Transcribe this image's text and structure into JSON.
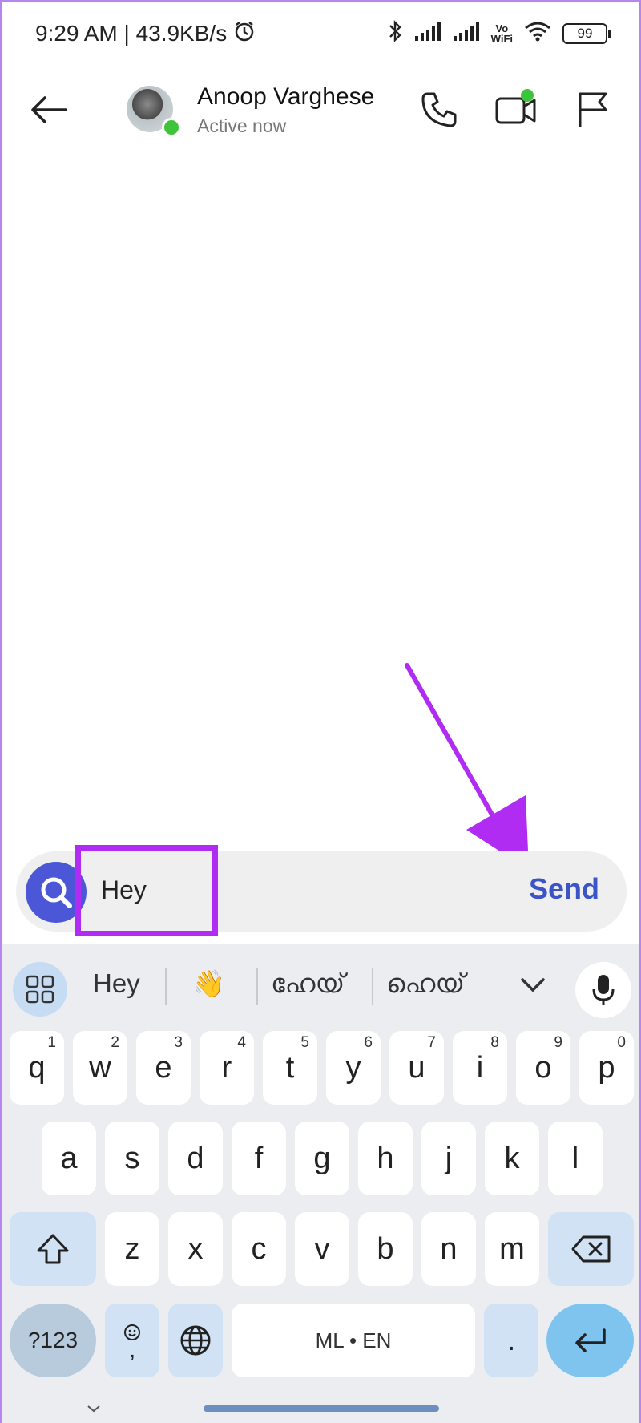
{
  "status_bar": {
    "time_speed": "9:29 AM | 43.9KB/s",
    "battery": "99",
    "vowifi_top": "Vo",
    "vowifi_bottom": "WiFi"
  },
  "header": {
    "contact_name": "Anoop Varghese",
    "contact_status": "Active now"
  },
  "composer": {
    "text": "Hey",
    "send_label": "Send"
  },
  "keyboard": {
    "suggestions": [
      "Hey",
      "👋",
      "ഹേയ്",
      "ഹെയ്"
    ],
    "row1": [
      {
        "k": "q",
        "n": "1"
      },
      {
        "k": "w",
        "n": "2"
      },
      {
        "k": "e",
        "n": "3"
      },
      {
        "k": "r",
        "n": "4"
      },
      {
        "k": "t",
        "n": "5"
      },
      {
        "k": "y",
        "n": "6"
      },
      {
        "k": "u",
        "n": "7"
      },
      {
        "k": "i",
        "n": "8"
      },
      {
        "k": "o",
        "n": "9"
      },
      {
        "k": "p",
        "n": "0"
      }
    ],
    "row2": [
      "a",
      "s",
      "d",
      "f",
      "g",
      "h",
      "j",
      "k",
      "l"
    ],
    "row3": [
      "z",
      "x",
      "c",
      "v",
      "b",
      "n",
      "m"
    ],
    "symbols_label": "?123",
    "comma_label": ",",
    "space_label": "ML • EN",
    "period_label": "."
  },
  "colors": {
    "accent_purple": "#b02cf2",
    "send_blue": "#3c54c8",
    "online_green": "#3ec43a"
  }
}
